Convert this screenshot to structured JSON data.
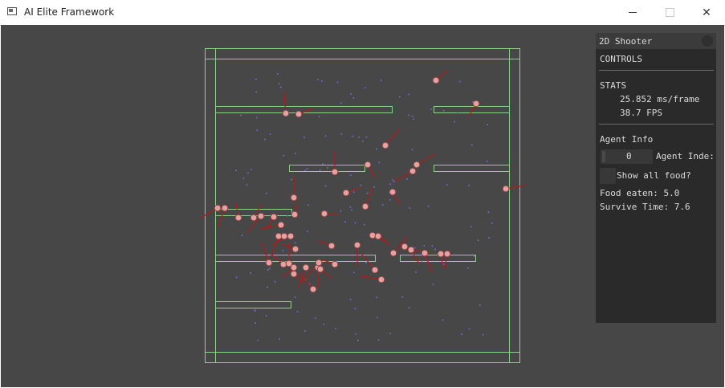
{
  "window": {
    "title": "AI Elite Framework",
    "controls": [
      "minimize",
      "maximize",
      "close"
    ]
  },
  "panel": {
    "title": "2D Shooter",
    "controls_header": "CONTROLS",
    "stats_header": "STATS",
    "ms_per_frame": "25.852 ms/frame",
    "fps": "38.7 FPS",
    "agent_info_header": "Agent Info",
    "agent_index_value": "0",
    "agent_index_label": "Agent Inde:",
    "show_all_food_label": "Show all food?",
    "food_eaten": "Food eaten: 5.0",
    "survive_time": "Survive Time: 7.6"
  },
  "colors": {
    "background": "#474747",
    "walls": "#8fd18c",
    "agents": "#e8a0a0",
    "sensor_rays": "#b31a1a",
    "food": "#6f6fe0",
    "panel": "#2a2a2a"
  }
}
